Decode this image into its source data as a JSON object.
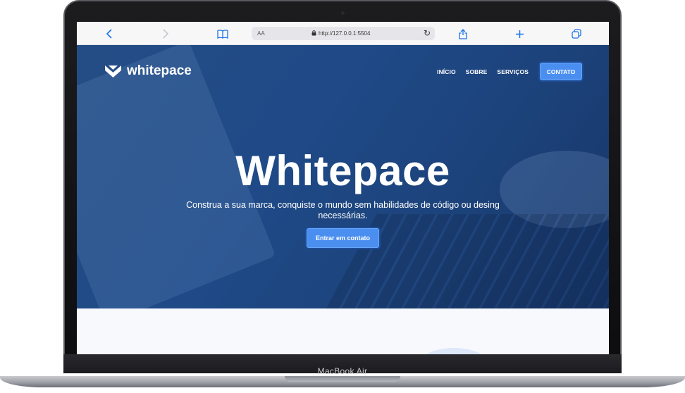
{
  "device": {
    "label": "MacBook Air"
  },
  "browser": {
    "text_size_label": "AA",
    "url": "http://127.0.0.1:5504",
    "icons": [
      "back-icon",
      "forward-icon",
      "bookmarks-icon",
      "lock-icon",
      "reload-icon",
      "share-icon",
      "new-tab-icon",
      "tabs-icon"
    ]
  },
  "site": {
    "brand": "whitepace",
    "nav": {
      "items": [
        "INÍCIO",
        "SOBRE",
        "SERVIÇOS"
      ],
      "cta": "CONTATO"
    },
    "hero": {
      "title": "Whitepace",
      "subtitle": "Construa a sua marca, conquiste o mundo sem habilidades de código ou desing necessárias.",
      "cta": "Entrar em contato"
    }
  },
  "colors": {
    "hero_bg": "#1f4a87",
    "accent": "#4a8ff0",
    "accent_border": "#1d4d99",
    "page_bg": "#f8f9fc"
  }
}
